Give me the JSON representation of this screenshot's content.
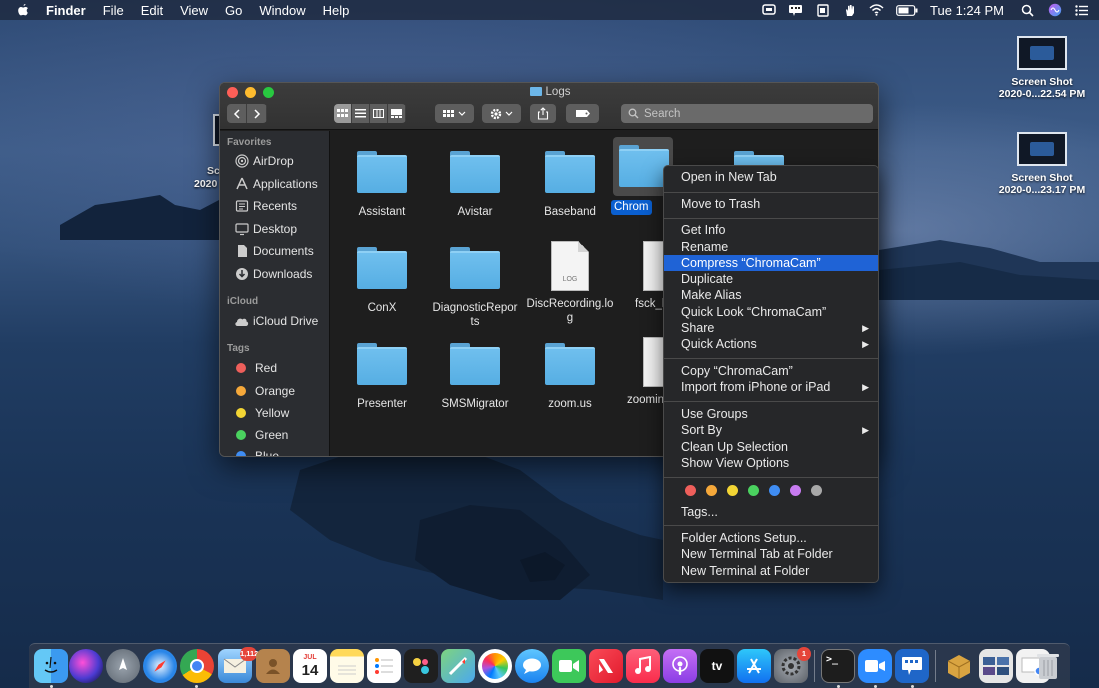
{
  "menubar": {
    "app_name": "Finder",
    "items": [
      "File",
      "Edit",
      "View",
      "Go",
      "Window",
      "Help"
    ],
    "clock": "Tue 1:24 PM",
    "status_icons": [
      "screen-mirror-icon",
      "remote-desktop-icon",
      "notes-icon",
      "hand-icon",
      "wifi-icon",
      "battery-icon"
    ]
  },
  "desktop": {
    "icons": [
      {
        "line1": "Screen Shot",
        "line2": "2020-0...22.54 PM"
      },
      {
        "line1": "Screen Shot",
        "line2": "2020-0...23.17 PM"
      }
    ],
    "partial_labels": [
      "Sc",
      "2020"
    ]
  },
  "finder": {
    "title": "Logs",
    "search_placeholder": "Search",
    "sidebar": {
      "favorites_header": "Favorites",
      "favorites": [
        "AirDrop",
        "Applications",
        "Recents",
        "Desktop",
        "Documents",
        "Downloads"
      ],
      "icloud_header": "iCloud",
      "icloud": [
        "iCloud Drive"
      ],
      "tags_header": "Tags",
      "tags": [
        {
          "label": "Red",
          "color": "#ee5f5b"
        },
        {
          "label": "Orange",
          "color": "#f5a83a"
        },
        {
          "label": "Yellow",
          "color": "#f3d534"
        },
        {
          "label": "Green",
          "color": "#4ad25f"
        },
        {
          "label": "Blue",
          "color": "#3f8df3"
        }
      ]
    },
    "files": [
      {
        "name": "Assistant",
        "kind": "folder"
      },
      {
        "name": "Avistar",
        "kind": "folder"
      },
      {
        "name": "Baseband",
        "kind": "folder"
      },
      {
        "name": "Chrom",
        "kind": "folder",
        "selected": true
      },
      {
        "name": "",
        "kind": "folder"
      },
      {
        "name": "ConX",
        "kind": "folder"
      },
      {
        "name": "DiagnosticReports",
        "kind": "folder"
      },
      {
        "name": "DiscRecording.log",
        "kind": "log",
        "badge": "LOG"
      },
      {
        "name": "fsck_h",
        "kind": "doc"
      },
      {
        "name": "Presenter",
        "kind": "folder"
      },
      {
        "name": "SMSMigrator",
        "kind": "folder"
      },
      {
        "name": "zoom.us",
        "kind": "folder"
      },
      {
        "name": "zoomin",
        "kind": "doc"
      }
    ]
  },
  "context_menu": {
    "items": [
      "Open in New Tab",
      "Move to Trash",
      "Get Info",
      "Rename",
      "Compress “ChromaCam”",
      "Duplicate",
      "Make Alias",
      "Quick Look “ChromaCam”",
      "Share",
      "Quick Actions",
      "Copy “ChromaCam”",
      "Import from iPhone or iPad",
      "Use Groups",
      "Sort By",
      "Clean Up Selection",
      "Show View Options",
      "Tags...",
      "Folder Actions Setup...",
      "New Terminal Tab at Folder",
      "New Terminal at Folder"
    ],
    "highlighted": "Compress “ChromaCam”",
    "tag_colors": [
      "#ee5f5b",
      "#f5a83a",
      "#f3d534",
      "#4ad25f",
      "#3f8df3",
      "#c77bf0",
      "#a8a8a8"
    ]
  },
  "dock": {
    "apps": [
      "Finder",
      "Siri",
      "Launchpad",
      "Safari",
      "Google Chrome",
      "Mail",
      "Contacts",
      "Calendar",
      "Notes",
      "Reminders",
      "Maps",
      "Photos",
      "Messages",
      "FaceTime",
      "News",
      "Music",
      "Podcasts",
      "TV",
      "App Store",
      "System Preferences",
      "Terminal",
      "Zoom",
      "Remote Desktop",
      "Archive Utility",
      "Screenshots",
      "Chrome Document",
      "Trash"
    ],
    "calendar_month": "JUL",
    "calendar_day": "14",
    "mail_badge": "1,112",
    "prefs_badge": "1",
    "tv_label": "tv"
  }
}
